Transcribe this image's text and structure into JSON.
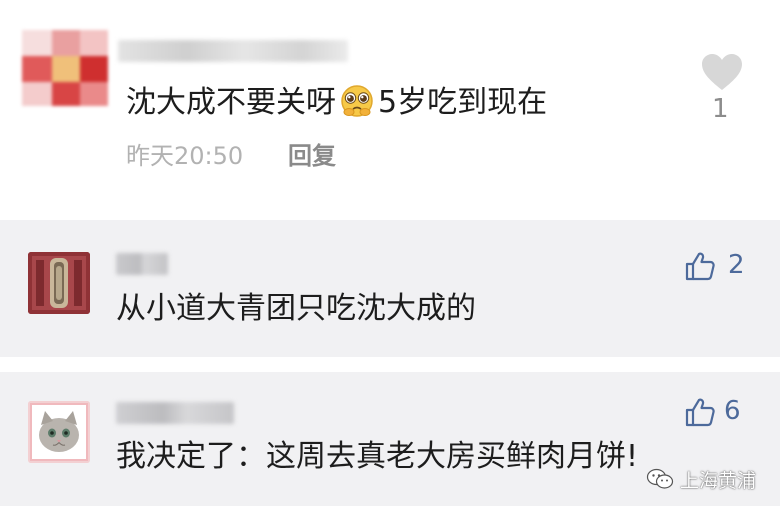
{
  "comments": [
    {
      "text_before": "沈大成不要关呀",
      "emoji_icon": "pleading-face-emoji",
      "text_after": "5岁吃到现在",
      "time": "昨天20:50",
      "reply_label": "回复",
      "like_count": "1"
    },
    {
      "text": "从小道大青团只吃沈大成的",
      "like_count": "2"
    },
    {
      "text": "我决定了：这周去真老大房买鲜肉月饼!",
      "like_count": "6"
    }
  ],
  "watermark": {
    "text": "上海黄浦"
  },
  "colors": {
    "like_blue": "#4d6a9b",
    "meta_gray": "#b2b2b2",
    "card_bg": "#f1f1f3"
  }
}
